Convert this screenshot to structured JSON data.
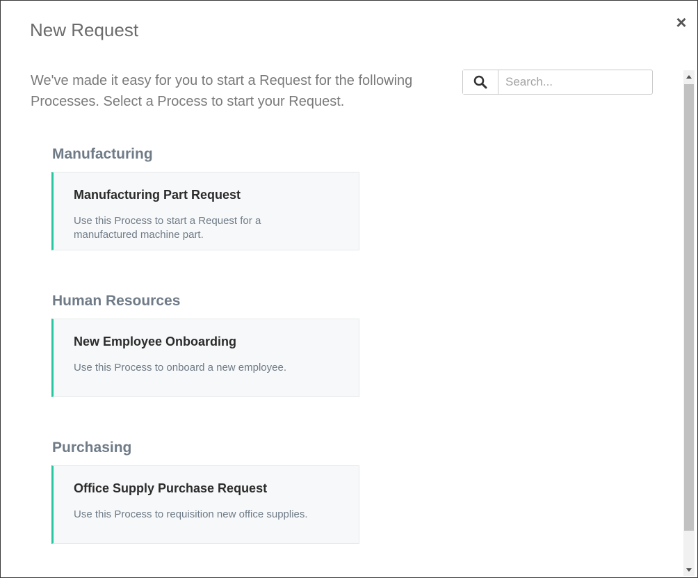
{
  "modal": {
    "title": "New Request",
    "close_label": "×"
  },
  "intro": {
    "text": "We've made it easy for you to start a Request for the following Processes. Select a Process to start your Request."
  },
  "search": {
    "placeholder": "Search...",
    "value": "",
    "icon": "search-icon"
  },
  "colors": {
    "card_accent": "#26c6a0",
    "category_heading": "#6f7b87"
  },
  "categories": [
    {
      "name": "Manufacturing",
      "process": {
        "title": "Manufacturing Part Request",
        "description": "Use this Process to start a Request for a manufactured machine part."
      }
    },
    {
      "name": "Human Resources",
      "process": {
        "title": "New Employee Onboarding",
        "description": "Use this Process to onboard a new employee."
      }
    },
    {
      "name": "Purchasing",
      "process": {
        "title": "Office Supply Purchase Request",
        "description": "Use this Process to requisition new office supplies."
      }
    }
  ]
}
